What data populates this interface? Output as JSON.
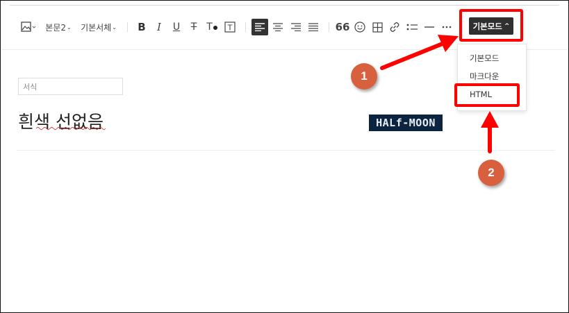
{
  "toolbar": {
    "paragraph_style": "본문2",
    "font_family": "기본서체",
    "mode_button": "기본모드"
  },
  "mode_menu": {
    "items": [
      "기본모드",
      "마크다운",
      "HTML"
    ]
  },
  "editor": {
    "format_placeholder": "서식",
    "title": "흰색 선없음",
    "image_text": "HALf-MOON"
  },
  "annotations": {
    "step1": "1",
    "step2": "2"
  },
  "colors": {
    "annotation_red": "#ff0000",
    "badge_orange": "#d9603e",
    "active_button": "#2f2f2f"
  }
}
